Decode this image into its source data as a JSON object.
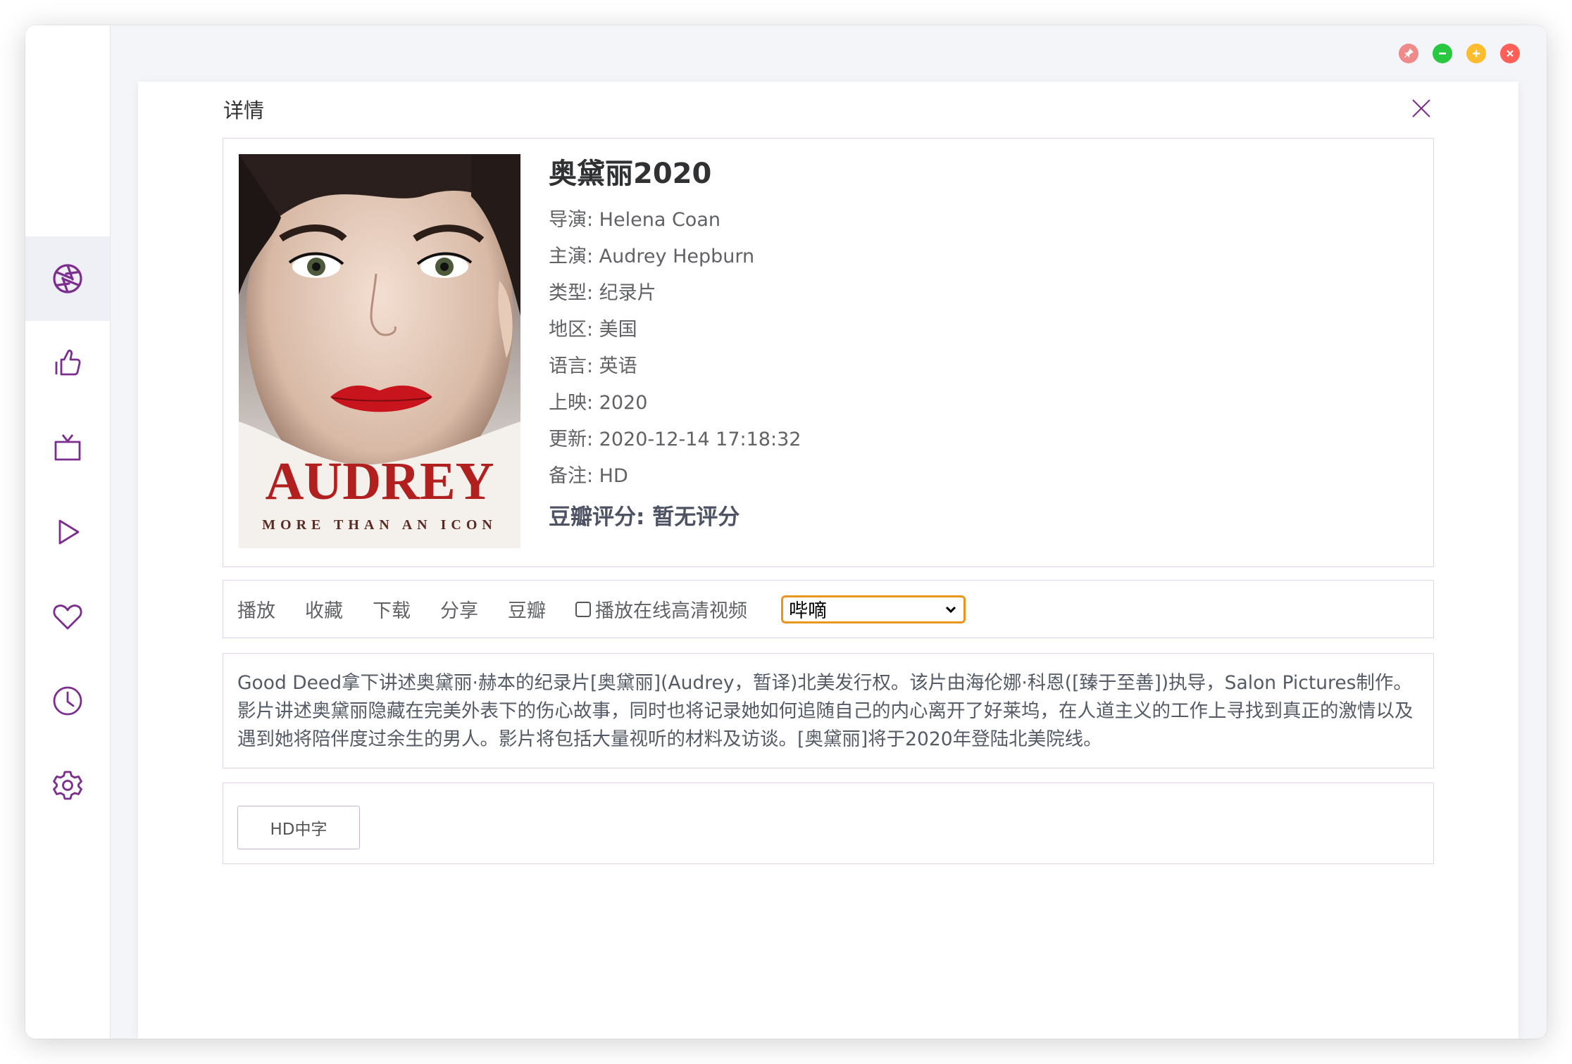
{
  "dialog": {
    "title": "详情"
  },
  "poster": {
    "title_text": "AUDREY",
    "tagline": "MORE THAN AN ICON"
  },
  "movie": {
    "title": "奥黛丽2020",
    "director": "导演: Helena Coan",
    "cast": "主演: Audrey Hepburn",
    "genre": "类型: 纪录片",
    "region": "地区: 美国",
    "language": "语言: 英语",
    "release": "上映: 2020",
    "updated": "更新: 2020-12-14 17:18:32",
    "note": "备注: HD",
    "douban_score": "豆瓣评分: 暂无评分"
  },
  "actions": {
    "play": "播放",
    "favorite": "收藏",
    "download": "下载",
    "share": "分享",
    "douban": "豆瓣",
    "hd_checkbox_label": "播放在线高清视频",
    "source_select": "哔嘀"
  },
  "description": "Good Deed拿下讲述奥黛丽·赫本的纪录片[奥黛丽](Audrey，暂译)北美发行权。该片由海伦娜·科恩([臻于至善])执导，Salon Pictures制作。影片讲述奥黛丽隐藏在完美外表下的伤心故事，同时也将记录她如何追随自己的内心离开了好莱坞，在人道主义的工作上寻找到真正的激情以及遇到她将陪伴度过余生的男人。影片将包括大量视听的材料及访谈。[奥黛丽]将于2020年登陆北美院线。",
  "episodes": [
    "HD中字"
  ],
  "sidebar": {
    "icons": [
      "aperture-icon",
      "thumbs-up-icon",
      "tv-icon",
      "play-icon",
      "heart-icon",
      "clock-icon",
      "settings-icon"
    ],
    "active": "aperture-icon"
  },
  "colors": {
    "accent": "#7b2e8e",
    "traffic_pin": "#ef8a8a",
    "traffic_minimize": "#28c840",
    "traffic_maximize": "#febc2e",
    "traffic_close": "#ff5f57",
    "select_border": "#e8961e"
  }
}
